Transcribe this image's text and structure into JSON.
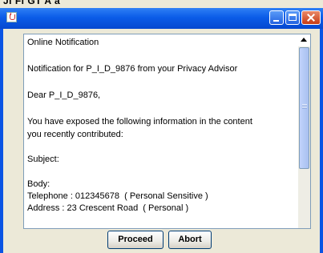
{
  "background_caption": "Jl Fl GT A a",
  "window": {
    "title_icon": "java-cup-icon",
    "controls": [
      "minimize-icon",
      "maximize-icon",
      "close-icon"
    ]
  },
  "message": {
    "lines": [
      "Online Notification",
      "Notification for P_I_D_9876 from your Privacy Advisor",
      "Dear P_I_D_9876,",
      "You have exposed the following information in the content",
      "you recently contributed:",
      "Subject:",
      "Body:",
      "Telephone : 012345678  ( Personal Sensitive )",
      "Address : 23 Crescent Road  ( Personal )"
    ]
  },
  "buttons": {
    "proceed": "Proceed",
    "abort": "Abort"
  },
  "colors": {
    "titlebar": "#0b5ce8",
    "close_button": "#c63b14",
    "dialog_background": "#ece9d8"
  }
}
